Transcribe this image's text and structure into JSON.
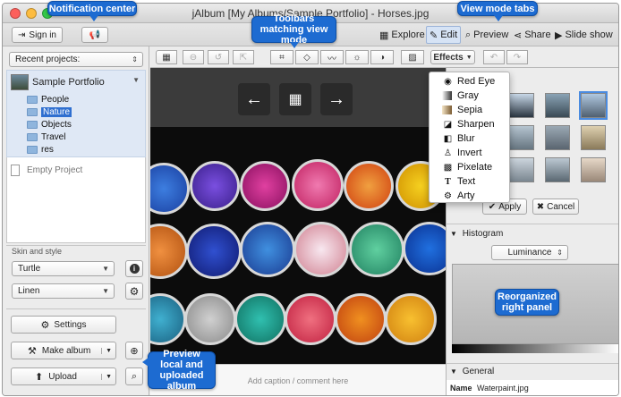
{
  "window": {
    "title": "jAlbum [My Albums/Sample Portfolio] - Horses.jpg"
  },
  "top_toolbar": {
    "sign_in": "Sign in",
    "tabs": [
      {
        "label": "Explore",
        "icon": "grid-icon"
      },
      {
        "label": "Edit",
        "icon": "pencil-icon"
      },
      {
        "label": "Preview",
        "icon": "magnifier-icon"
      },
      {
        "label": "Share",
        "icon": "share-icon"
      },
      {
        "label": "Slide show",
        "icon": "play-icon"
      }
    ]
  },
  "left": {
    "recent_projects": "Recent projects:",
    "project_name": "Sample Portfolio",
    "folders": [
      "People",
      "Nature",
      "Objects",
      "Travel",
      "res"
    ],
    "selected_folder": "Nature",
    "empty_project": "Empty Project",
    "skin_style_label": "Skin and style",
    "skin": "Turtle",
    "style": "Linen",
    "settings": "Settings",
    "make_album": "Make album",
    "upload": "Upload"
  },
  "center": {
    "effects_label": "Effects",
    "caption_placeholder": "Add caption / comment here"
  },
  "effects_menu": {
    "items": [
      {
        "label": "Red Eye",
        "icon": "eye-icon"
      },
      {
        "label": "Gray",
        "icon": "gray-swatch-icon"
      },
      {
        "label": "Sepia",
        "icon": "sepia-swatch-icon"
      },
      {
        "label": "Sharpen",
        "icon": "triangle-icon"
      },
      {
        "label": "Blur",
        "icon": "blur-icon"
      },
      {
        "label": "Invert",
        "icon": "invert-icon"
      },
      {
        "label": "Pixelate",
        "icon": "pixelate-icon"
      },
      {
        "label": "Text",
        "icon": "text-icon"
      },
      {
        "label": "Arty",
        "icon": "gear-icon"
      }
    ]
  },
  "right": {
    "apply": "Apply",
    "cancel": "Cancel",
    "histogram_label": "Histogram",
    "histogram_mode": "Luminance",
    "general_label": "General",
    "name_key": "Name",
    "name_value": "Waterpaint.jpg"
  },
  "callouts": {
    "notification": "Notification center",
    "view_mode_tabs": "View mode tabs",
    "toolbars": "Toolbars matching view mode",
    "reorganized": "Reorganized right panel",
    "preview_local": "Preview local and uploaded album"
  },
  "colors": {
    "accent": "#1d6bd1",
    "selection": "#2f6fd0"
  }
}
